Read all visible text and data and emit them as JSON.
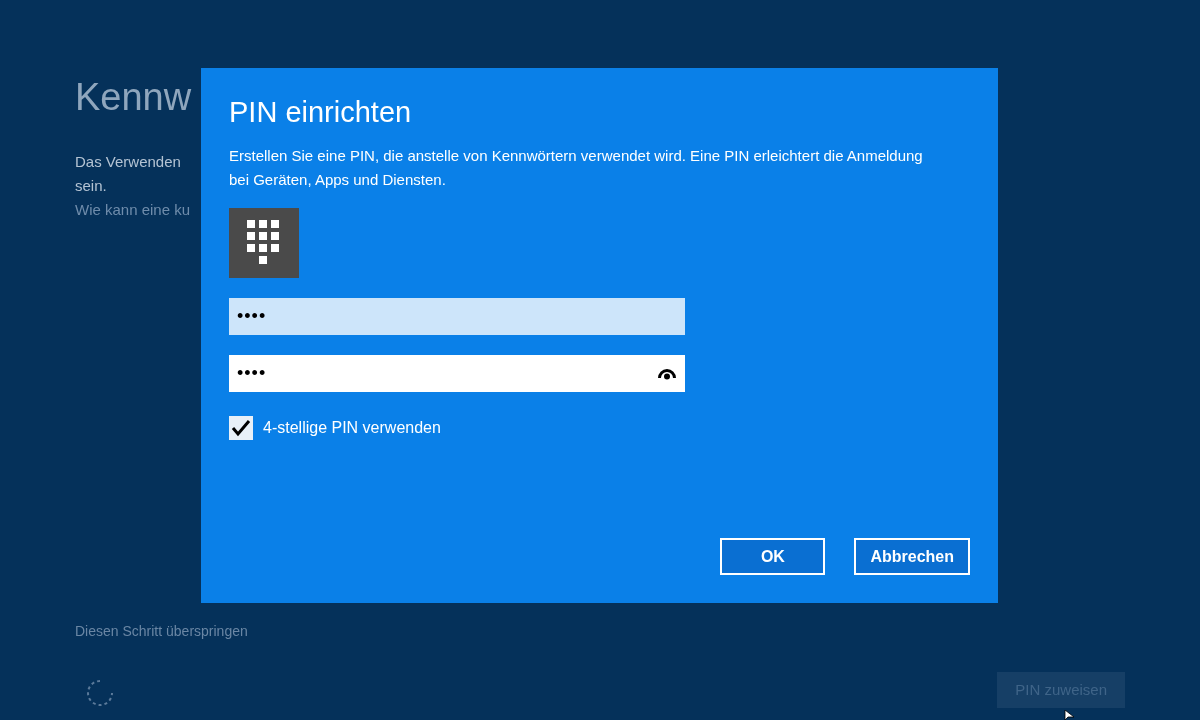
{
  "background": {
    "title": "Kennw",
    "text_lines": [
      "Das Verwenden",
      "sein."
    ],
    "link": "Wie kann eine ku",
    "skip_link": "Diesen Schritt überspringen",
    "assign_button": {
      "label": "PIN zuweisen",
      "disabled": true
    }
  },
  "dialog": {
    "title": "PIN einrichten",
    "description": "Erstellen Sie eine PIN, die anstelle von Kennwörtern verwendet wird. Eine PIN erleichtert die Anmeldung bei Geräten, Apps und Diensten.",
    "fields": [
      {
        "value": "••••",
        "focused": true,
        "reveal_icon": false
      },
      {
        "value": "••••",
        "focused": false,
        "reveal_icon": true
      }
    ],
    "checkbox": {
      "label": "4-stellige PIN verwenden",
      "checked": true
    },
    "buttons": [
      "OK",
      "Abbrechen"
    ]
  }
}
